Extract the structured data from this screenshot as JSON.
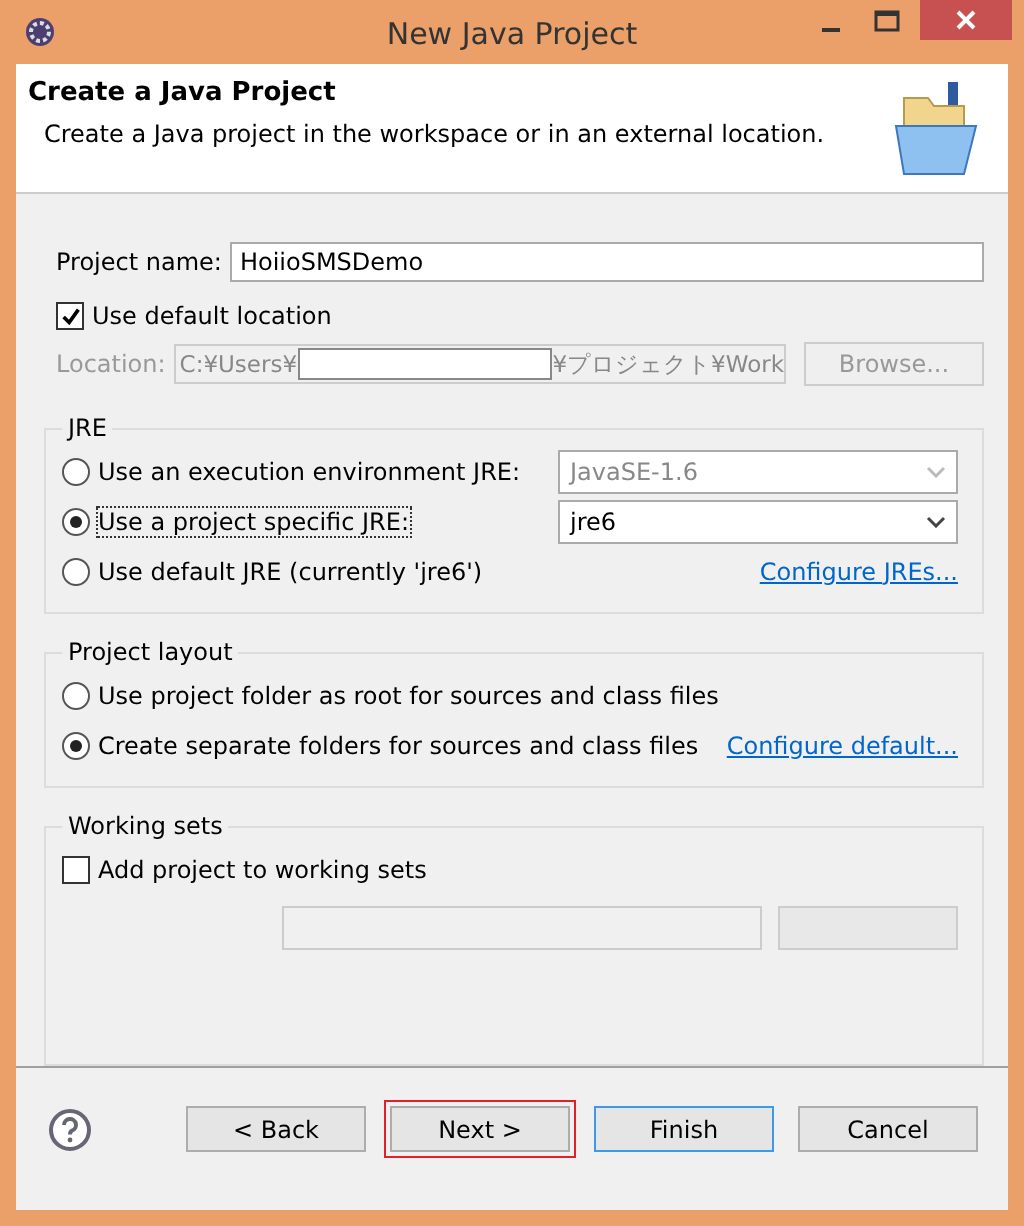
{
  "window": {
    "title": "New Java Project"
  },
  "header": {
    "title": "Create a Java Project",
    "description": "Create a Java project in the workspace or in an external location."
  },
  "project_name": {
    "label": "Project name:",
    "value": "HoiioSMSDemo"
  },
  "use_default_location": {
    "label": "Use default location",
    "checked": true
  },
  "location": {
    "label": "Location:",
    "prefix": "C:¥Users¥",
    "suffix": "¥プロジェクト¥Work",
    "disabled": true,
    "browse": "Browse..."
  },
  "jre": {
    "title": "JRE",
    "options": [
      {
        "label": "Use an execution environment JRE:",
        "selected": false,
        "kind": "select",
        "value": "JavaSE-1.6",
        "disabled": true
      },
      {
        "label": "Use a project specific JRE:",
        "selected": true,
        "kind": "select",
        "value": "jre6",
        "disabled": false
      },
      {
        "label": "Use default JRE (currently 'jre6')",
        "selected": false,
        "kind": "link",
        "link": "Configure JREs..."
      }
    ]
  },
  "project_layout": {
    "title": "Project layout",
    "options": [
      {
        "label": "Use project folder as root for sources and class files",
        "selected": false
      },
      {
        "label": "Create separate folders for sources and class files",
        "selected": true
      }
    ],
    "link": "Configure default..."
  },
  "working_sets": {
    "title": "Working sets",
    "add": {
      "label": "Add project to working sets",
      "checked": false
    }
  },
  "buttons": [
    {
      "label": "< Back",
      "default": false,
      "highlighted": false
    },
    {
      "label": "Next >",
      "default": false,
      "highlighted": true
    },
    {
      "label": "Finish",
      "default": true,
      "highlighted": false
    },
    {
      "label": "Cancel",
      "default": false,
      "highlighted": false
    }
  ]
}
